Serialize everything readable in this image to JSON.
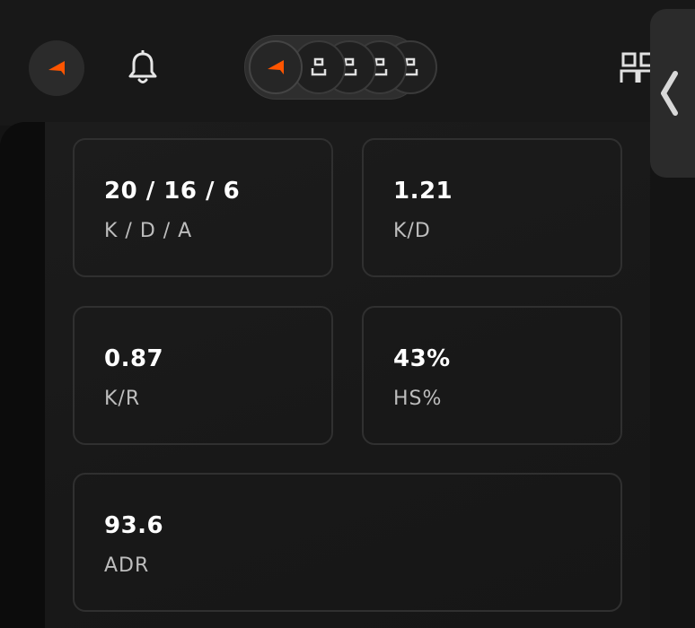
{
  "header": {
    "logo_icon": "faceit-arrow-icon",
    "notifications_icon": "bell-icon",
    "party": {
      "leader_icon": "faceit-arrow-icon",
      "empty_slot_icon": "empty-player-slot-icon",
      "empty_slots": 4
    },
    "friends_icon": "friends-icon",
    "side_panel_icon": "chevron-left-icon"
  },
  "stats": [
    {
      "value": "20 / 16 / 6",
      "label": "K / D / A"
    },
    {
      "value": "1.21",
      "label": "K/D"
    },
    {
      "value": "0.87",
      "label": "K/R"
    },
    {
      "value": "43%",
      "label": "HS%"
    },
    {
      "value": "93.6",
      "label": "ADR"
    }
  ],
  "colors": {
    "accent": "#ff5500",
    "background": "#141414",
    "card_border": "#303030",
    "label_text": "#bdbdbd"
  }
}
